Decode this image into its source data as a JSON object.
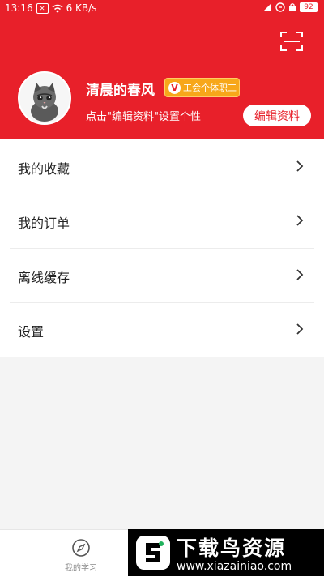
{
  "status_bar": {
    "time": "13:16",
    "network_speed": "6 KB/s",
    "battery": "92"
  },
  "header": {
    "scan_icon": "scan-icon",
    "username": "清晨的春风",
    "badge_letter": "V",
    "badge_label": "工会个体职工",
    "hint": "点击\"编辑资料\"设置个性",
    "edit_button": "编辑资料",
    "accent_color": "#e8202a"
  },
  "menu": {
    "items": [
      {
        "label": "我的收藏"
      },
      {
        "label": "我的订单"
      },
      {
        "label": "离线缓存"
      },
      {
        "label": "设置"
      }
    ]
  },
  "tabbar": {
    "study_label": "我的学习"
  },
  "watermark": {
    "title": "下载鸟资源",
    "url": "www.xiazainiao.com"
  }
}
